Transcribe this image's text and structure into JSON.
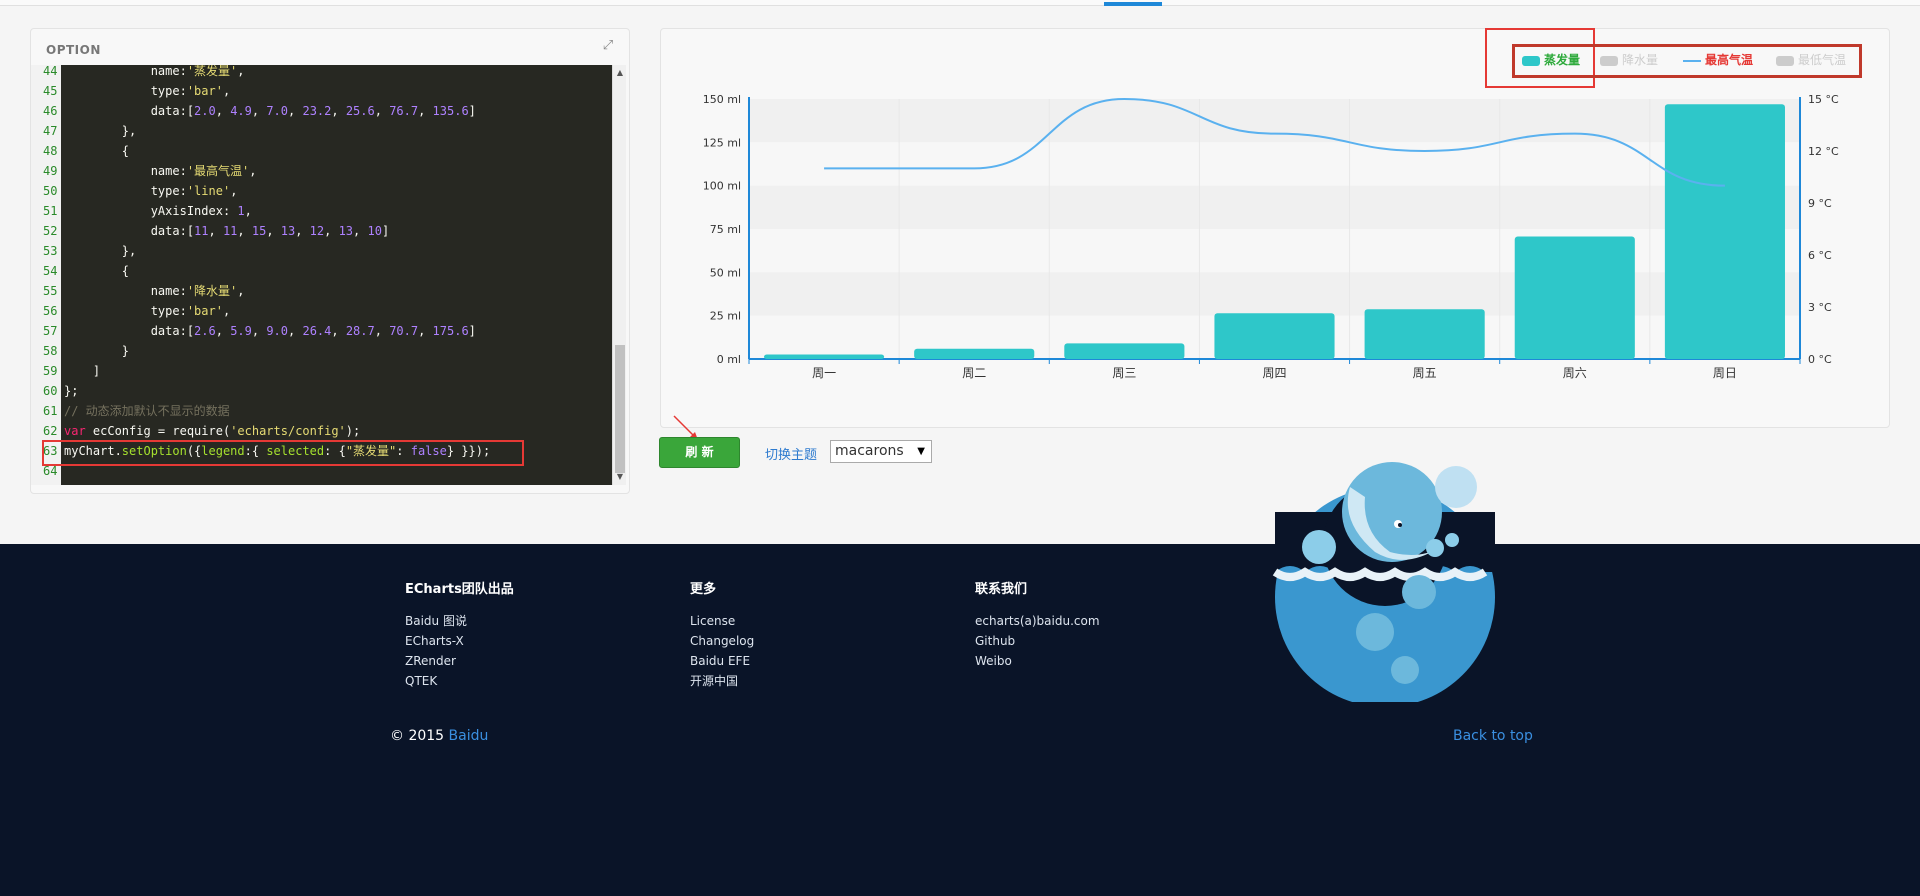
{
  "editor": {
    "title": "OPTION",
    "lines": [
      {
        "n": "44",
        "html": "            name:<span class=\"str\">'蒸发量'</span>,"
      },
      {
        "n": "45",
        "html": "            type:<span class=\"str\">'bar'</span>,"
      },
      {
        "n": "46",
        "html": "            data:[<span class=\"num\">2.0</span>, <span class=\"num\">4.9</span>, <span class=\"num\">7.0</span>, <span class=\"num\">23.2</span>, <span class=\"num\">25.6</span>, <span class=\"num\">76.7</span>, <span class=\"num\">135.6</span>]"
      },
      {
        "n": "47",
        "html": "        },"
      },
      {
        "n": "48",
        "html": "        {"
      },
      {
        "n": "49",
        "html": "            name:<span class=\"str\">'最高气温'</span>,"
      },
      {
        "n": "50",
        "html": "            type:<span class=\"str\">'line'</span>,"
      },
      {
        "n": "51",
        "html": "            yAxisIndex: <span class=\"num\">1</span>,"
      },
      {
        "n": "52",
        "html": "            data:[<span class=\"num\">11</span>, <span class=\"num\">11</span>, <span class=\"num\">15</span>, <span class=\"num\">13</span>, <span class=\"num\">12</span>, <span class=\"num\">13</span>, <span class=\"num\">10</span>]"
      },
      {
        "n": "53",
        "html": "        },"
      },
      {
        "n": "54",
        "html": "        {"
      },
      {
        "n": "55",
        "html": "            name:<span class=\"str\">'降水量'</span>,"
      },
      {
        "n": "56",
        "html": "            type:<span class=\"str\">'bar'</span>,"
      },
      {
        "n": "57",
        "html": "            data:[<span class=\"num\">2.6</span>, <span class=\"num\">5.9</span>, <span class=\"num\">9.0</span>, <span class=\"num\">26.4</span>, <span class=\"num\">28.7</span>, <span class=\"num\">70.7</span>, <span class=\"num\">175.6</span>]"
      },
      {
        "n": "58",
        "html": "        }"
      },
      {
        "n": "59",
        "html": "    ]"
      },
      {
        "n": "60",
        "html": "};"
      },
      {
        "n": "61",
        "html": "<span class=\"cm\">// 动态添加默认不显示的数据</span>"
      },
      {
        "n": "62",
        "html": "<span class=\"kw\">var</span> ecConfig = require(<span class=\"str\">'echarts/config'</span>);"
      },
      {
        "n": "63",
        "html": "myChart.<span class=\"fn\">setOption</span>({<span class=\"fn\">legend</span>:{ <span class=\"fn\">selected</span>: {<span class=\"str\">\"蒸发量\"</span>: <span class=\"num\">false</span>} }});"
      },
      {
        "n": "64",
        "html": ""
      }
    ]
  },
  "legend": [
    {
      "label": "蒸发量",
      "color": "#2eaa3c",
      "active": true,
      "icon": "bar-swatch-icon"
    },
    {
      "label": "降水量",
      "color": "#cccccc",
      "active": false,
      "icon": "bar-swatch-icon"
    },
    {
      "label": "最高气温",
      "color": "#e53935",
      "active": true,
      "icon": "line-swatch-icon"
    },
    {
      "label": "最低气温",
      "color": "#cccccc",
      "active": false,
      "icon": "bar-swatch-icon"
    }
  ],
  "chart_data": {
    "type": "bar",
    "categories": [
      "周一",
      "周二",
      "周三",
      "周四",
      "周五",
      "周六",
      "周日"
    ],
    "series": [
      {
        "name": "降水量",
        "type": "bar",
        "values": [
          2.6,
          5.9,
          9.0,
          26.4,
          28.7,
          70.7,
          175.6
        ],
        "color": "#2ec7c9"
      },
      {
        "name": "最高气温",
        "type": "line",
        "yAxisIndex": 1,
        "values": [
          11,
          11,
          15,
          13,
          12,
          13,
          10
        ],
        "color": "#5ab1ef"
      }
    ],
    "ylim": [
      0,
      150
    ],
    "y_ticks": [
      "0 ml",
      "25 ml",
      "50 ml",
      "75 ml",
      "100 ml",
      "125 ml",
      "150 ml"
    ],
    "y2lim": [
      0,
      15
    ],
    "y2_ticks": [
      "0 °C",
      "3 °C",
      "6 °C",
      "9 °C",
      "12 °C",
      "15 °C"
    ],
    "grid": true,
    "legend_position": "top-right"
  },
  "controls": {
    "refresh_label": "刷 新",
    "theme_label": "切换主题",
    "theme_value": "macarons"
  },
  "footer": {
    "columns": [
      {
        "title": "ECharts团队出品",
        "links": [
          "Baidu 图说",
          "ECharts-X",
          "ZRender",
          "QTEK"
        ]
      },
      {
        "title": "更多",
        "links": [
          "License",
          "Changelog",
          "Baidu EFE",
          "开源中国"
        ]
      },
      {
        "title": "联系我们",
        "links": [
          "echarts(a)baidu.com",
          "Github",
          "Weibo"
        ]
      }
    ],
    "copyright_prefix": "© 2015",
    "copyright_link": "Baidu",
    "back_to_top": "Back to top"
  }
}
